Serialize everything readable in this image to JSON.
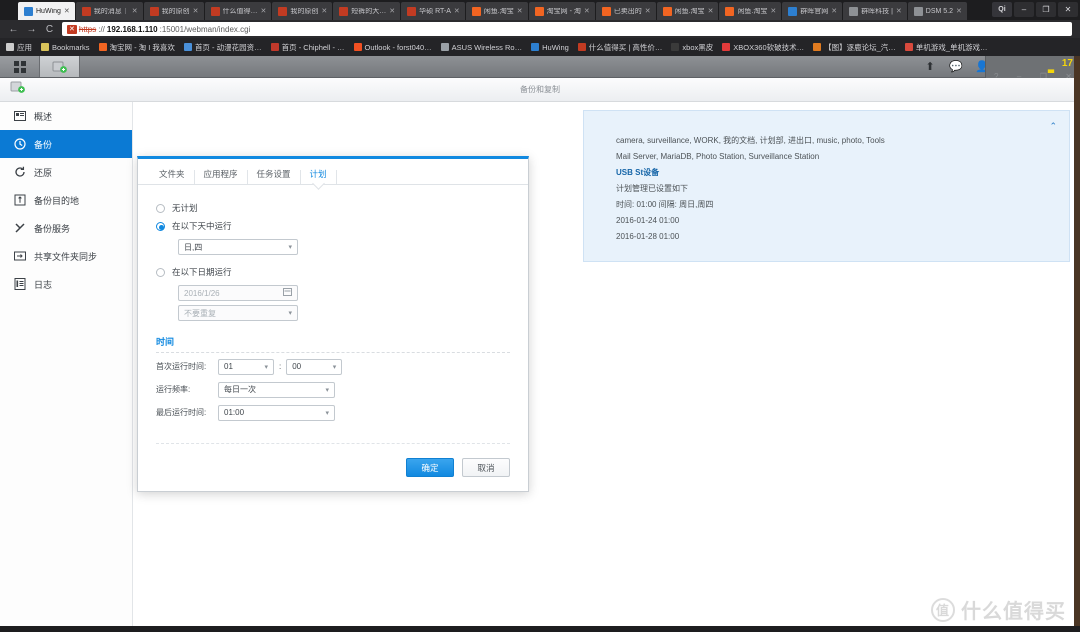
{
  "browser": {
    "tabs": [
      {
        "label": "HuWing",
        "favicon": "#2d7fd0",
        "active": true
      },
      {
        "label": "我的消息｜",
        "favicon": "#c23b22",
        "active": false
      },
      {
        "label": "我的原创",
        "favicon": "#c23b22",
        "active": false
      },
      {
        "label": "什么值得…",
        "favicon": "#c23b22",
        "active": false
      },
      {
        "label": "我的原创",
        "favicon": "#c23b22",
        "active": false
      },
      {
        "label": "短裤的大…",
        "favicon": "#c23b22",
        "active": false
      },
      {
        "label": "华硕 RT-A",
        "favicon": "#c23b22",
        "active": false
      },
      {
        "label": "闲鱼.淘宝",
        "favicon": "#f26522",
        "active": false
      },
      {
        "label": "淘宝网 - 淘",
        "favicon": "#f26522",
        "active": false
      },
      {
        "label": "已卖出的",
        "favicon": "#f26522",
        "active": false
      },
      {
        "label": "闲鱼.淘宝",
        "favicon": "#f26522",
        "active": false
      },
      {
        "label": "闲鱼.淘宝",
        "favicon": "#f26522",
        "active": false
      },
      {
        "label": "群晖官网",
        "favicon": "#2d7fd0",
        "active": false
      },
      {
        "label": "群晖科技 |",
        "favicon": "#8e9195",
        "active": false
      },
      {
        "label": "DSM 5.2",
        "favicon": "#8e9195",
        "active": false
      }
    ],
    "tab_close_glyph": "✕",
    "window_controls": {
      "account": "Qi",
      "minimize": "–",
      "maximize": "❐",
      "close": "✕"
    },
    "nav": {
      "back": "←",
      "forward": "→",
      "reload": "C"
    },
    "url": {
      "warning_badge": "✕",
      "scheme": "https",
      "separator": "://",
      "host": "192.168.1.110",
      "rest": ":15001/webman/index.cgi"
    },
    "bookmarks": [
      {
        "label": "应用",
        "color": "#cccccc",
        "icon": "apps-grid-icon"
      },
      {
        "label": "Bookmarks",
        "color": "#d8c25a",
        "icon": "star-icon"
      },
      {
        "label": "淘宝网 - 淘 I 我喜欢",
        "color": "#f26522",
        "icon": "taobao-icon"
      },
      {
        "label": "首页 - 动漫花园资…",
        "color": "#4a90d9",
        "icon": "dmhy-icon"
      },
      {
        "label": "首页 - Chiphell - …",
        "color": "#c0392b",
        "icon": "chiphell-icon"
      },
      {
        "label": "Outlook - forst040…",
        "color": "#f25022",
        "icon": "outlook-icon"
      },
      {
        "label": "ASUS Wireless Ro…",
        "color": "#9aa0a6",
        "icon": "asus-icon"
      },
      {
        "label": "HuWing",
        "color": "#2d7fd0",
        "icon": "huwing-icon"
      },
      {
        "label": "什么值得买 | 高性价…",
        "color": "#c23b22",
        "icon": "smzdm-icon"
      },
      {
        "label": "xbox黑皮",
        "color": "#3a3a3a",
        "icon": "xbox-icon"
      },
      {
        "label": "XBOX360软破技术…",
        "color": "#e23b3b",
        "icon": "xbox360-icon"
      },
      {
        "label": "【图】逐鹿论坛_汽…",
        "color": "#e07b20",
        "icon": "forum-icon"
      },
      {
        "label": "单机游戏_单机游戏…",
        "color": "#d94a3d",
        "icon": "game-icon"
      }
    ]
  },
  "dsm": {
    "taskbar": {
      "apps_button": "apps-grid-icon",
      "open_app": "backup-app-icon",
      "icons": [
        {
          "name": "upload-icon",
          "glyph": "⬆"
        },
        {
          "name": "chat-icon",
          "glyph": "💬"
        },
        {
          "name": "user-icon",
          "glyph": "👤"
        },
        {
          "name": "search-icon",
          "glyph": "🔍"
        },
        {
          "name": "notification-icon",
          "glyph": "◉"
        },
        {
          "name": "widgets-icon",
          "glyph": "▤"
        }
      ],
      "badge_count": "17",
      "wave_glyph": "▃"
    },
    "window": {
      "title": "备份和复制",
      "icon": "backup-app-icon"
    },
    "sidebar": {
      "items": [
        {
          "label": "概述",
          "icon": "overview-icon",
          "active": false
        },
        {
          "label": "备份",
          "icon": "backup-clock-icon",
          "active": true
        },
        {
          "label": "还原",
          "icon": "restore-icon",
          "active": false
        },
        {
          "label": "备份目的地",
          "icon": "destination-icon",
          "active": false
        },
        {
          "label": "备份服务",
          "icon": "service-wrench-icon",
          "active": false
        },
        {
          "label": "共享文件夹同步",
          "icon": "folder-sync-icon",
          "active": false
        },
        {
          "label": "日志",
          "icon": "log-icon",
          "active": false
        }
      ]
    },
    "info_card": {
      "collapse_glyph": "⌃",
      "lines": [
        {
          "text": "camera, surveillance, WORK, 我的文档, 计划部, 进出口, music, photo, Tools",
          "strong": false
        },
        {
          "text": "Mail Server, MariaDB, Photo Station, Surveillance Station",
          "strong": false
        },
        {
          "text": "USB St设备",
          "strong": true
        },
        {
          "text": "计划管理已设置如下",
          "strong": false
        },
        {
          "text": "时间: 01:00 间隔: 周日,周四",
          "strong": false
        },
        {
          "text": "2016-01-24 01:00",
          "strong": false
        },
        {
          "text": "2016-01-28 01:00",
          "strong": false
        }
      ]
    }
  },
  "dialog": {
    "tabs": [
      {
        "label": "文件夹",
        "active": false
      },
      {
        "label": "应用程序",
        "active": false
      },
      {
        "label": "任务设置",
        "active": false
      },
      {
        "label": "计划",
        "active": true
      }
    ],
    "schedule_options": [
      {
        "label": "无计划",
        "checked": false
      },
      {
        "label": "在以下天中运行",
        "checked": true
      },
      {
        "label": "在以下日期运行",
        "checked": false
      }
    ],
    "days_select": {
      "value": "日,四",
      "caret": "▾"
    },
    "date_field": {
      "value": "2016/1/26",
      "icon": "calendar-icon"
    },
    "repeat_select": {
      "value": "不要重复",
      "caret": "▾"
    },
    "time_section": {
      "title": "时间",
      "first_run_label": "首次运行时间:",
      "first_run_hour": "01",
      "time_separator": ":",
      "first_run_minute": "00",
      "frequency_label": "运行频率:",
      "frequency_value": "每日一次",
      "last_run_label": "最后运行时间:",
      "last_run_value": "01:00"
    },
    "buttons": {
      "ok": "确定",
      "cancel": "取消"
    }
  },
  "watermark": {
    "mark": "值",
    "text": "什么值得买"
  }
}
